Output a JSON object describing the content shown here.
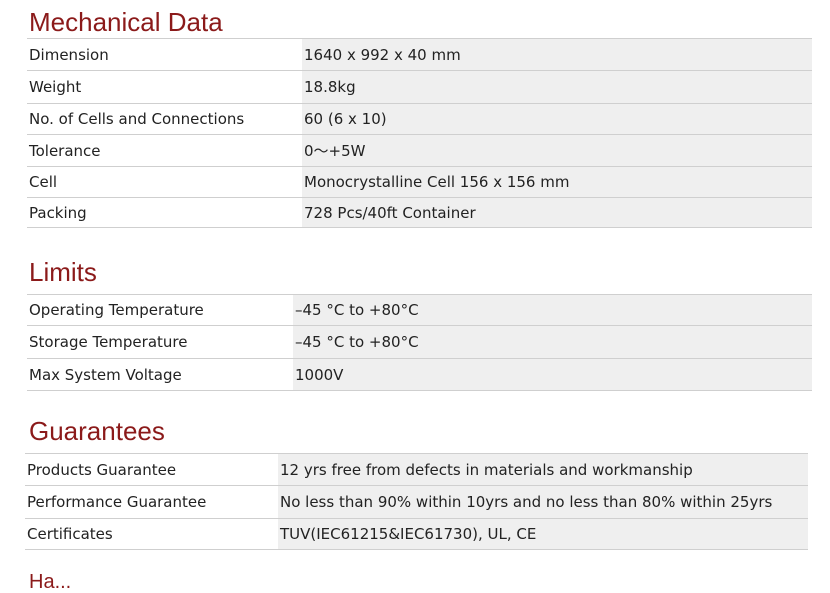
{
  "mechanical": {
    "title": "Mechanical Data",
    "rows": [
      {
        "label": "Dimension",
        "value": "1640 x 992 x 40 mm"
      },
      {
        "label": "Weight",
        "value": "18.8kg"
      },
      {
        "label": "No. of Cells and Connections",
        "value": "60 (6 x 10)"
      },
      {
        "label": "Tolerance",
        "value": "0～+5W"
      },
      {
        "label": "Cell",
        "value": "Monocrystalline Cell 156 x 156 mm"
      },
      {
        "label": "Packing",
        "value": "728 Pcs/40ft Container"
      }
    ]
  },
  "limits": {
    "title": "Limits",
    "rows": [
      {
        "label": "Operating Temperature",
        "value": "–45 °C to +80°C"
      },
      {
        "label": "Storage Temperature",
        "value": "–45 °C to +80°C"
      },
      {
        "label": "Max System Voltage",
        "value": "1000V"
      }
    ]
  },
  "guarantees": {
    "title": "Guarantees",
    "rows": [
      {
        "label": "Products Guarantee",
        "value": "12 yrs free from defects in materials and workmanship"
      },
      {
        "label": "Performance Guarantee",
        "value": "No less than 90% within 10yrs and no less than 80% within 25yrs"
      },
      {
        "label": "Certificates",
        "value": "TUV(IEC61215&IEC61730), UL, CE"
      }
    ]
  },
  "next_section": {
    "partial_title": "Ha..."
  },
  "colors": {
    "heading": "#8b1a1a",
    "value_cell_bg": "#efefef",
    "row_border": "#cfcfcf"
  }
}
